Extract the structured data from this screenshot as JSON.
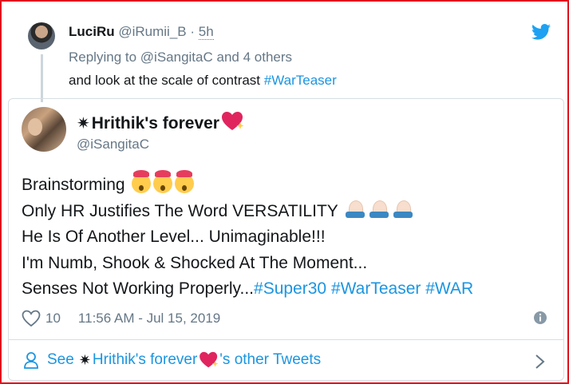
{
  "reply": {
    "name": "LuciRu",
    "handle": "@iRumii_B",
    "dot": "·",
    "time": "5h",
    "replying_prefix": "Replying to",
    "replying_user": "@iSangitaC",
    "replying_suffix": "and 4 others",
    "text": "and look at the scale of contrast",
    "hashtag": "#WarTeaser"
  },
  "quoted": {
    "star": "✷",
    "author_name": "Hrithik's forever",
    "author_handle": "@iSangitaC",
    "lines": {
      "l1": "Brainstorming",
      "l2": "Only HR Justifies The Word VERSATILITY",
      "l3": "He Is Of Another Level... Unimaginable!!!",
      "l4": "I'm Numb, Shook & Shocked At The Moment...",
      "l5_text": "Senses Not Working Properly...",
      "tag1": "#Super30",
      "tag2": "#WarTeaser",
      "tag3": "#WAR"
    },
    "emoji_face": "shocked-face-emoji",
    "emoji_hands": "folded-hands-emoji",
    "likes": "10",
    "timestamp": "11:56 AM - Jul 15, 2019"
  },
  "footer": {
    "see": "See",
    "star": "✷",
    "name": "Hrithik's forever",
    "suffix": "'s other Tweets"
  },
  "colors": {
    "accent": "#1b95e0",
    "muted": "#657786",
    "frame": "#e0141e",
    "heart": "#e0245e"
  }
}
